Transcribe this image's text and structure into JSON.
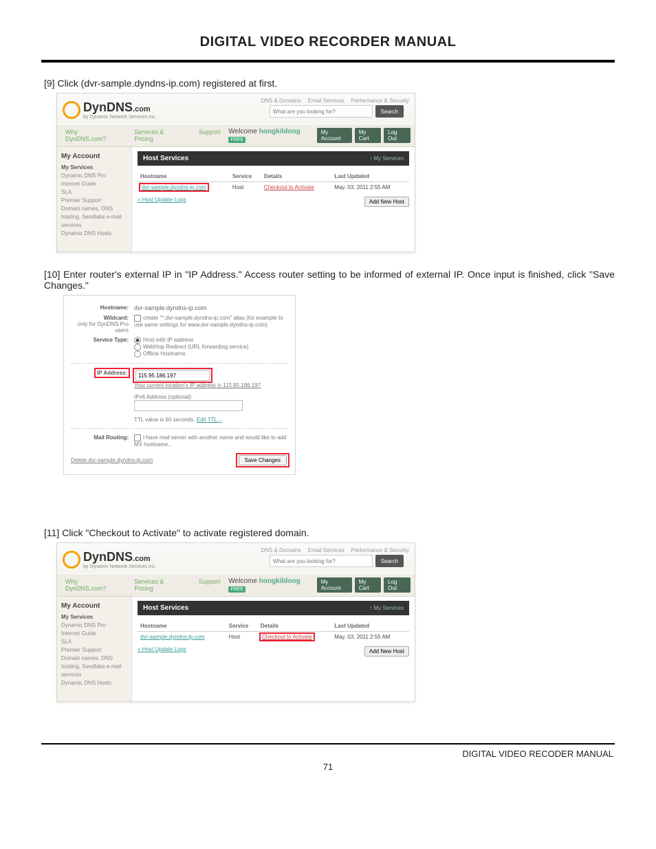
{
  "title": "DIGITAL VIDEO RECORDER MANUAL",
  "steps": {
    "s9": "[9] Click (dvr-sample.dyndns-ip.com) registered at first.",
    "s10": "[10] Enter router's external IP in \"IP Address.\" Access router setting to be informed of external IP. Once input is finished, click \"Save Changes.\"",
    "s11": "[11] Click \"Checkout to Activate\" to activate registered domain."
  },
  "dyn": {
    "logo": "DynDNS",
    "logoSuffix": ".com",
    "logoSub": "by Dynamic Network Services Inc.",
    "toplinks": [
      "DNS & Domains",
      "Email Services",
      "Performance & Security"
    ],
    "searchPlaceholder": "What are you looking for?",
    "searchBtn": "Search",
    "nav": [
      "Why DynDNS.com?",
      "Services & Pricing",
      "Support"
    ],
    "welcomePrefix": "Welcome ",
    "welcomeUser": "hongkildong",
    "welcomeBadge": "FREE",
    "chips": [
      "My Account",
      "My Cart",
      "Log Out"
    ],
    "side": {
      "account": "My Account",
      "h5": "My Services",
      "items": [
        "Dynamic DNS Pro",
        "Internet Guide",
        "SLA",
        "Premier Support",
        "Domain names, DNS hosting, Sendlabs e-mail services",
        "Dynamic DNS Hosts"
      ]
    },
    "panelTitle": "Host Services",
    "panelLink": "↑ My Services",
    "cols": [
      "Hostname",
      "Service",
      "Details",
      "Last Updated"
    ],
    "row": {
      "hostname": "dvr-sample.dyndns-ip.com",
      "service": "Host",
      "details": "Checkout to Activate",
      "updated": "May. 03, 2011 2:55 AM"
    },
    "hostUpdateLogs": "» Host Update Logs",
    "addNewHost": "Add New Host"
  },
  "form": {
    "labels": {
      "hostname": "Hostname:",
      "wildcard": "Wildcard:",
      "wildcardNote": "only for DynDNS Pro users",
      "serviceType": "Service Type:",
      "ip": "IP Address:",
      "mail": "Mail Routing:"
    },
    "hostname": "dvr-sample.dyndns-ip.com",
    "wildcardText": "create \"*.dvr-sample.dyndns-ip.com\" alias (for example to use same settings for www.dvr-sample.dyndns-ip.com)",
    "svc": [
      "Host with IP address",
      "WebHop Redirect (URL forwarding service)",
      "Offline Hostname"
    ],
    "ipValue": "115.95.186.197",
    "ipHelp": "Your current location's IP address is 115.95.186.197",
    "ipv6label": "IPv6 Address (optional):",
    "ttl": "TTL value is 60 seconds. ",
    "ttlLink": "Edit TTL...",
    "mailText": "I have mail server with another name and would like to add MX hostname...",
    "saveBtn": "Save Changes",
    "deleteLink": "Delete dvr-sample.dyndns-ip.com"
  },
  "footer": {
    "right": "DIGITAL VIDEO RECODER MANUAL",
    "page": "71"
  }
}
